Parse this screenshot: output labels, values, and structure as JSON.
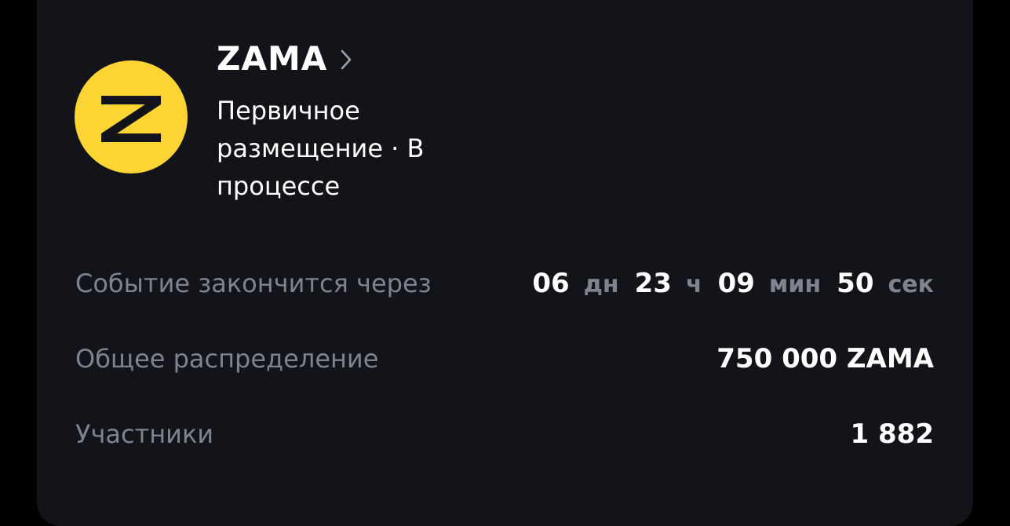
{
  "project": {
    "name": "ZAMA",
    "subtitle": "Первичное размещение · В процессе",
    "logo_letter": "Z",
    "logo_color": "#FCD434"
  },
  "rows": {
    "countdown": {
      "label": "Событие закончится через",
      "days": "06",
      "days_unit": "дн",
      "hours": "23",
      "hours_unit": "ч",
      "minutes": "09",
      "minutes_unit": "мин",
      "seconds": "50",
      "seconds_unit": "сек"
    },
    "distribution": {
      "label": "Общее распределение",
      "value": "750 000 ZAMA"
    },
    "participants": {
      "label": "Участники",
      "value": "1 882"
    }
  },
  "icons": {
    "chevron": "chevron-right-icon"
  },
  "colors": {
    "background": "#000000",
    "card": "#131419",
    "text_primary": "#FFFFFF",
    "text_secondary": "#7E838F"
  }
}
